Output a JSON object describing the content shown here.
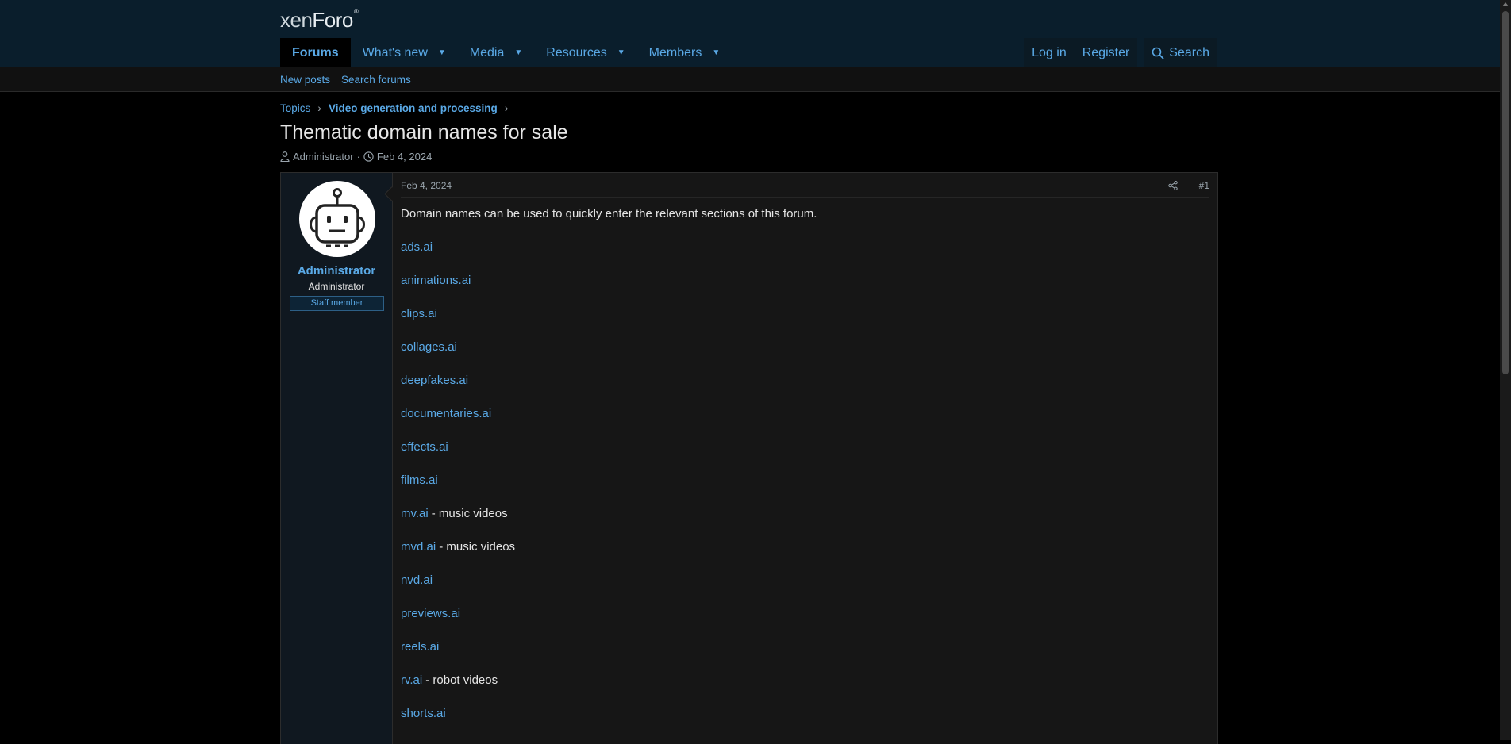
{
  "header": {
    "logo_main": "xenForo",
    "nav": [
      {
        "label": "Forums",
        "has_menu": false
      },
      {
        "label": "What's new",
        "has_menu": true
      },
      {
        "label": "Media",
        "has_menu": true
      },
      {
        "label": "Resources",
        "has_menu": true
      },
      {
        "label": "Members",
        "has_menu": true
      }
    ],
    "login_label": "Log in",
    "register_label": "Register",
    "search_label": "Search"
  },
  "subnav": {
    "new_posts": "New posts",
    "search_forums": "Search forums"
  },
  "breadcrumb": [
    "Topics",
    "Video generation and processing"
  ],
  "thread": {
    "title": "Thematic domain names for sale",
    "author": "Administrator",
    "date": "Feb 4, 2024"
  },
  "post": {
    "username": "Administrator",
    "user_title": "Administrator",
    "badge": "Staff member",
    "date": "Feb 4, 2024",
    "number": "#1",
    "intro": "Domain names can be used to quickly enter the relevant sections of this forum.",
    "domains": [
      {
        "link": "ads.ai",
        "note": ""
      },
      {
        "link": "animations.ai",
        "note": ""
      },
      {
        "link": "clips.ai",
        "note": ""
      },
      {
        "link": "collages.ai",
        "note": ""
      },
      {
        "link": "deepfakes.ai",
        "note": ""
      },
      {
        "link": "documentaries.ai",
        "note": ""
      },
      {
        "link": "effects.ai",
        "note": ""
      },
      {
        "link": "films.ai",
        "note": ""
      },
      {
        "link": "mv.ai",
        "note": "- music videos"
      },
      {
        "link": "mvd.ai",
        "note": "- music videos"
      },
      {
        "link": "nvd.ai",
        "note": ""
      },
      {
        "link": "previews.ai",
        "note": ""
      },
      {
        "link": "reels.ai",
        "note": ""
      },
      {
        "link": "rv.ai",
        "note": "- robot videos"
      },
      {
        "link": "shorts.ai",
        "note": ""
      }
    ]
  },
  "colors": {
    "header_bg": "#0a1e2c",
    "link": "#5aa9e6",
    "page_bg": "#000000",
    "post_bg": "#161616"
  }
}
